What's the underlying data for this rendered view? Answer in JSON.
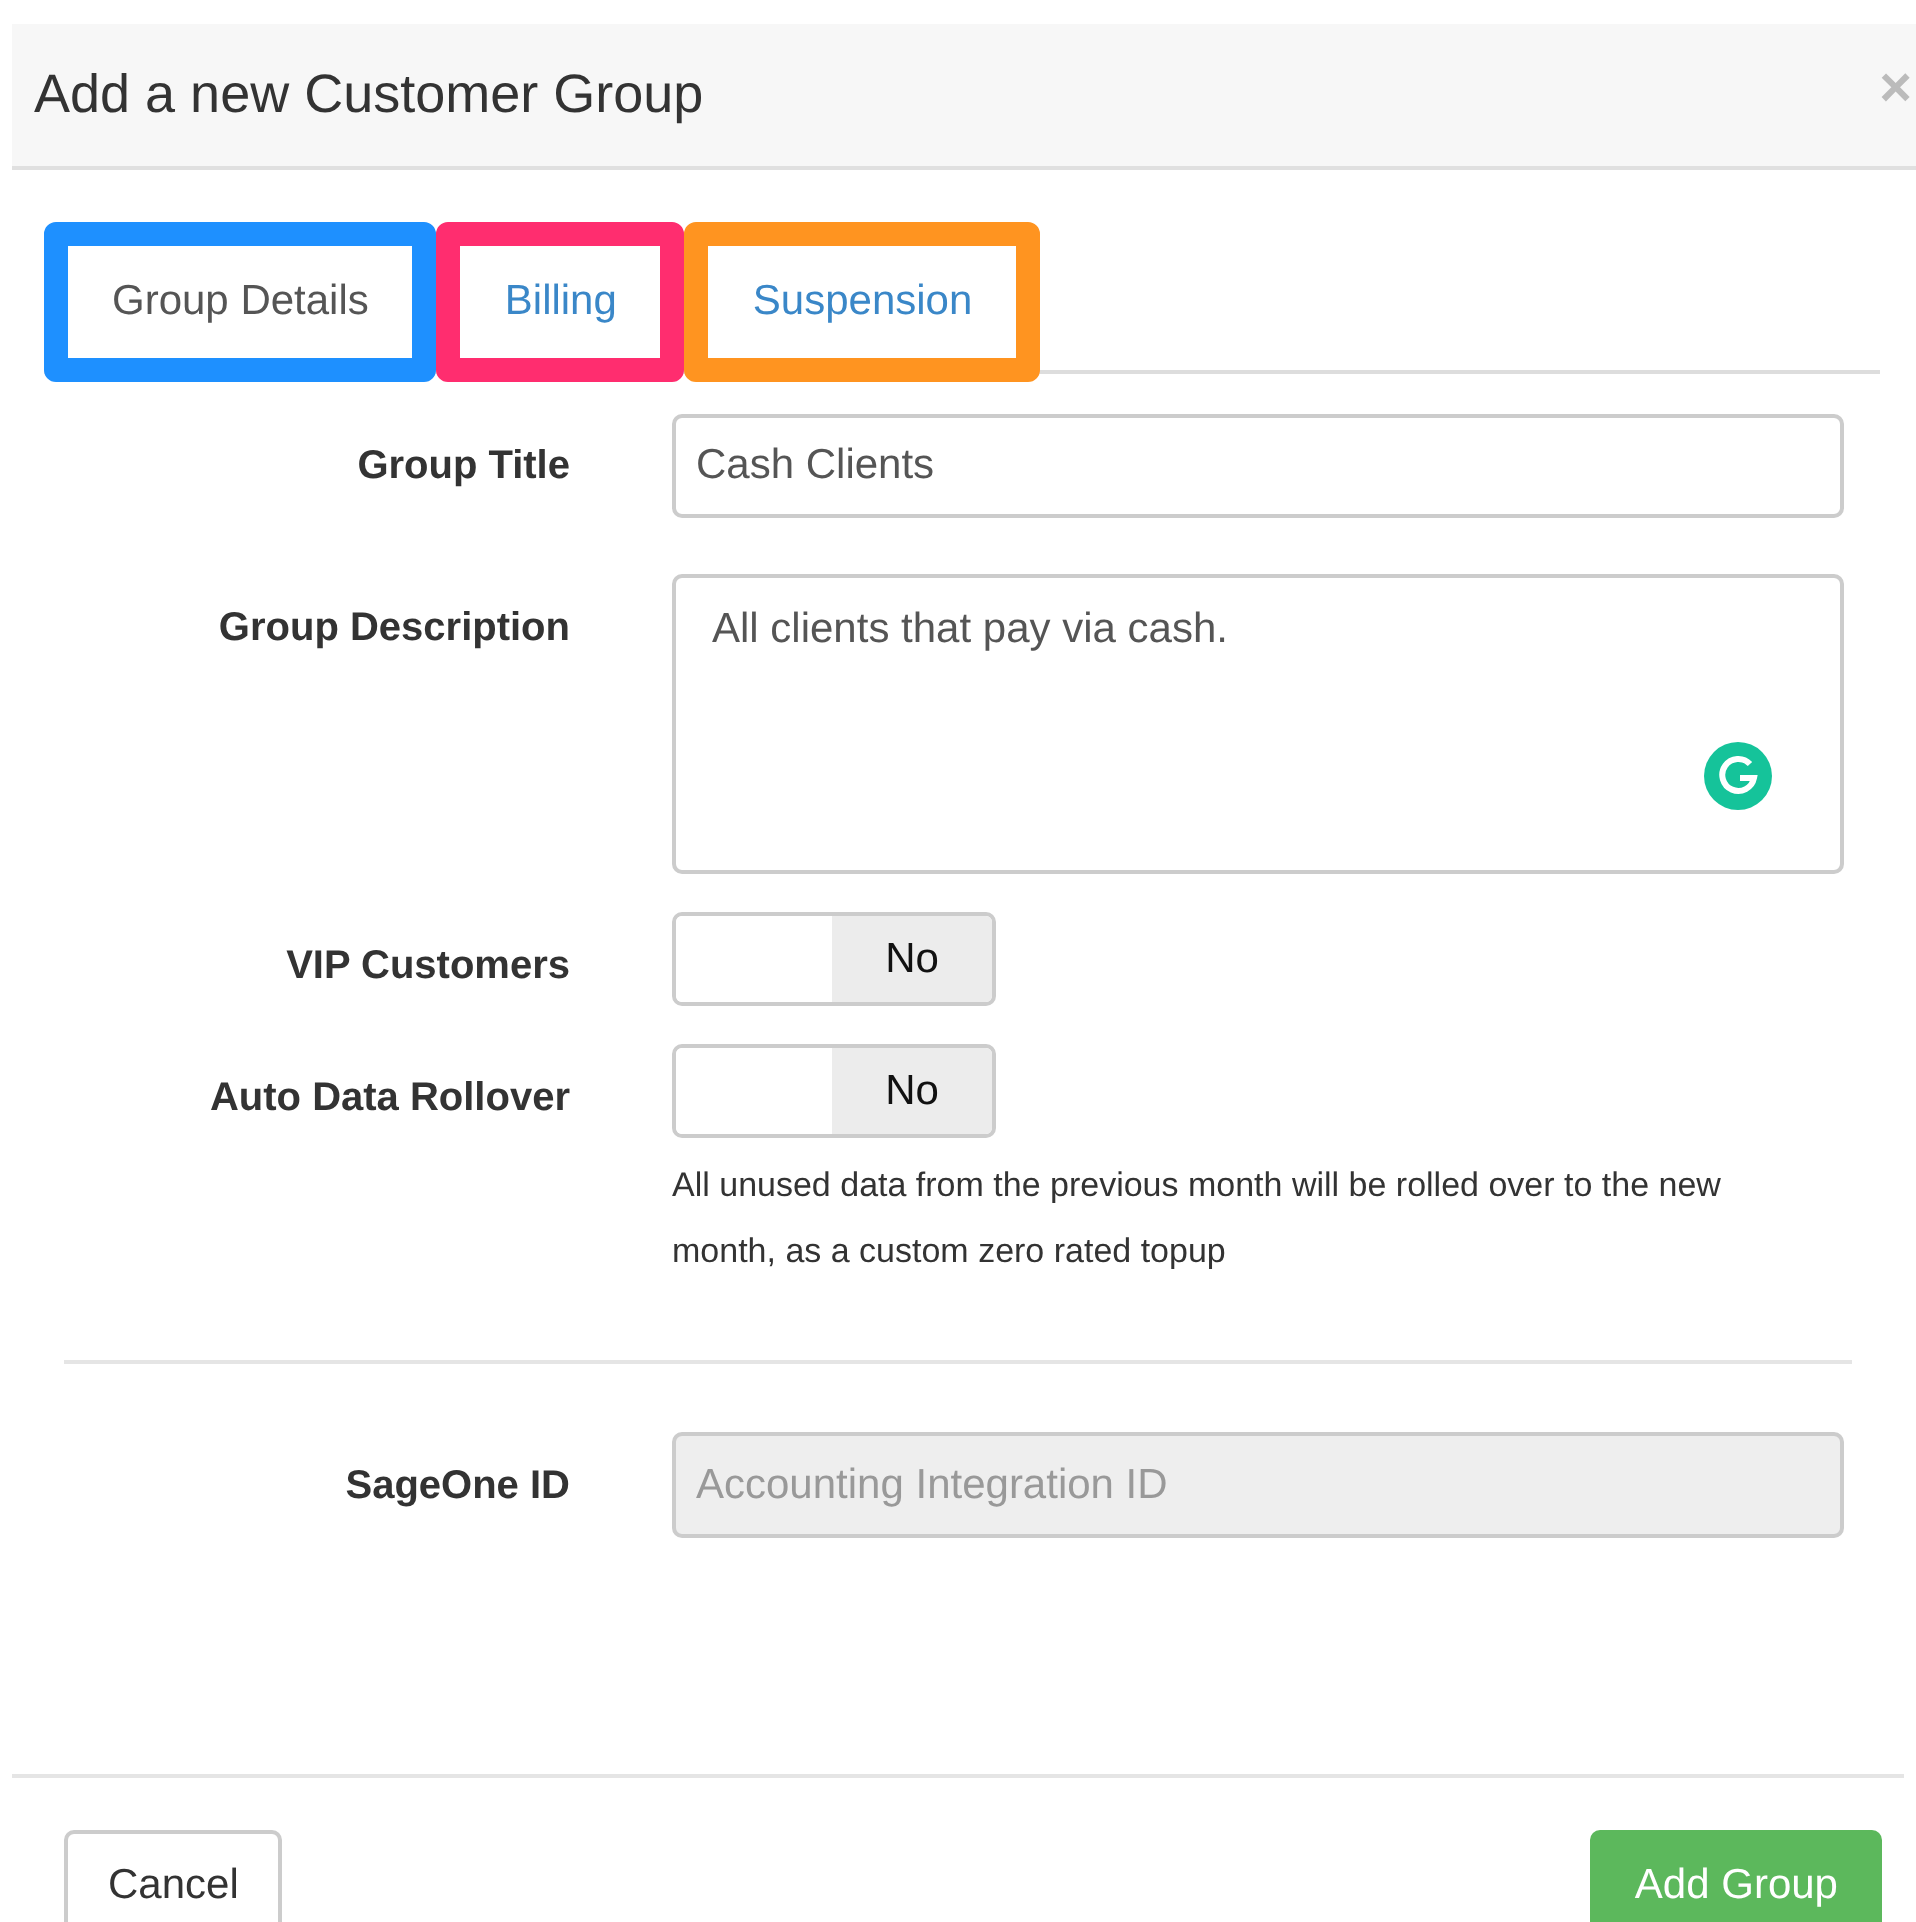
{
  "dialog": {
    "title": "Add a new Customer Group",
    "close": "×"
  },
  "tabs": [
    {
      "label": "Group Details",
      "selected": true,
      "color": "#1e90ff"
    },
    {
      "label": "Billing",
      "selected": false,
      "color": "#ff2d6f"
    },
    {
      "label": "Suspension",
      "selected": false,
      "color": "#ff9420"
    }
  ],
  "fields": [
    {
      "kind": "text",
      "label": "Group Title",
      "value": "Cash Clients"
    },
    {
      "kind": "textarea",
      "label": "Group Description",
      "value": "All clients that pay via cash."
    },
    {
      "kind": "toggle",
      "label": "VIP Customers",
      "value": "No",
      "on": false
    },
    {
      "kind": "toggle",
      "label": "Auto Data Rollover",
      "value": "No",
      "on": false,
      "help": "All unused data from the previous month will be rolled over to the new month, as a custom zero rated topup"
    }
  ],
  "integration": {
    "label": "SageOne ID",
    "placeholder": "Accounting Integration ID",
    "disabled": true
  },
  "footer": {
    "cancel": "Cancel",
    "submit": "Add Group"
  }
}
